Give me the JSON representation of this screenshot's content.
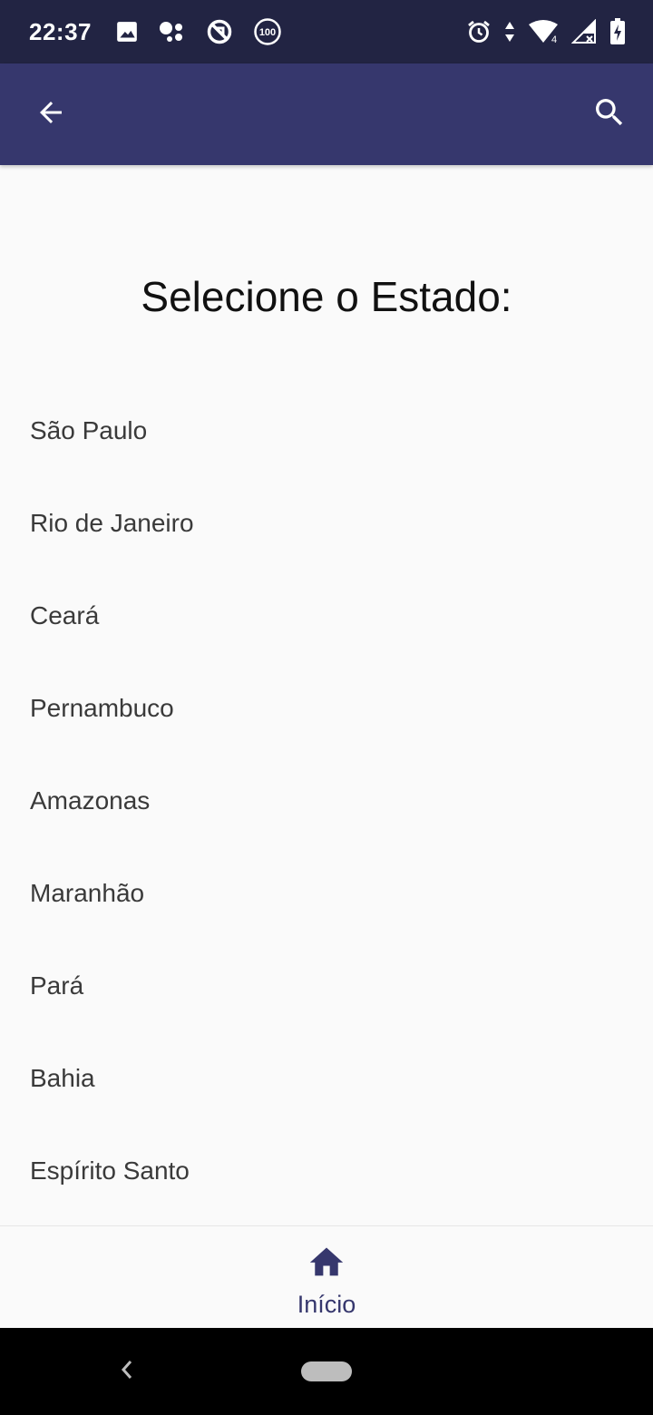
{
  "status_bar": {
    "time": "22:37",
    "left_icons": [
      "image-icon",
      "assistant-icon",
      "data-saver-icon",
      "badge-100-icon"
    ],
    "badge_text": "100",
    "right_icons": [
      "alarm-icon",
      "data-arrows-icon",
      "wifi-icon",
      "cell-signal-icon",
      "battery-charging-icon"
    ],
    "wifi_label": "4"
  },
  "app_bar": {
    "back_icon": "arrow-back-icon",
    "search_icon": "search-icon",
    "color": "#36376d"
  },
  "main": {
    "title": "Selecione o Estado:",
    "states": [
      {
        "label": "São Paulo"
      },
      {
        "label": "Rio de Janeiro"
      },
      {
        "label": "Ceará"
      },
      {
        "label": "Pernambuco"
      },
      {
        "label": "Amazonas"
      },
      {
        "label": "Maranhão"
      },
      {
        "label": "Pará"
      },
      {
        "label": "Bahia"
      },
      {
        "label": "Espírito Santo"
      }
    ]
  },
  "bottom_nav": {
    "items": [
      {
        "label": "Início",
        "icon": "home-icon",
        "active": true
      }
    ],
    "active_color": "#36376d"
  },
  "system_nav": {
    "back_icon": "chevron-left-icon",
    "home_icon": "home-pill-icon"
  }
}
